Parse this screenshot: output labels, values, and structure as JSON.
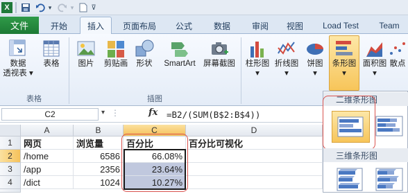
{
  "title_bar": {
    "app_icon": "excel-icon",
    "save_icon": "save-icon",
    "undo_icon": "undo-icon",
    "redo_icon": "redo-icon",
    "new_icon": "new-document-icon"
  },
  "tabs": [
    {
      "label": "文件"
    },
    {
      "label": "开始"
    },
    {
      "label": "插入"
    },
    {
      "label": "页面布局"
    },
    {
      "label": "公式"
    },
    {
      "label": "数据"
    },
    {
      "label": "审阅"
    },
    {
      "label": "视图"
    },
    {
      "label": "Load Test"
    },
    {
      "label": "Team"
    }
  ],
  "ribbon": {
    "tables": [
      {
        "label1": "数据",
        "label2": "透视表 ▾"
      },
      {
        "label1": "表格",
        "label2": ""
      }
    ],
    "tables_group": "表格",
    "illustrations": [
      {
        "label": "图片"
      },
      {
        "label": "剪贴画"
      },
      {
        "label": "形状"
      },
      {
        "label": "SmartArt"
      },
      {
        "label": "屏幕截图"
      }
    ],
    "illustrations_group": "插图",
    "charts": [
      {
        "label": "柱形图"
      },
      {
        "label": "折线图"
      },
      {
        "label": "饼图"
      },
      {
        "label": "条形图"
      },
      {
        "label": "面积图"
      },
      {
        "label": "散点"
      }
    ]
  },
  "formula_bar": {
    "name_box": "C2",
    "fx": "fx",
    "formula": "=B2/(SUM(B$2:B$4))"
  },
  "grid": {
    "columns": [
      "A",
      "B",
      "C",
      "D"
    ],
    "rows": [
      "1",
      "2",
      "3",
      "4"
    ],
    "cells": [
      [
        "网页",
        "浏览量",
        "百分比",
        "百分比可视化"
      ],
      [
        "/home",
        "6586",
        "66.08%",
        ""
      ],
      [
        "/app",
        "2356",
        "23.64%",
        ""
      ],
      [
        "/dict",
        "1024",
        "10.27%",
        ""
      ]
    ],
    "bar_fractions": [
      0.6608,
      0.2364,
      0.1027
    ]
  },
  "dropdown": {
    "section1": "二维条形图",
    "section2": "三维条形图"
  },
  "colors": {
    "accent_red": "#d9534f",
    "file_green": "#2f9a48",
    "selection_orange": "#f5c15a"
  }
}
